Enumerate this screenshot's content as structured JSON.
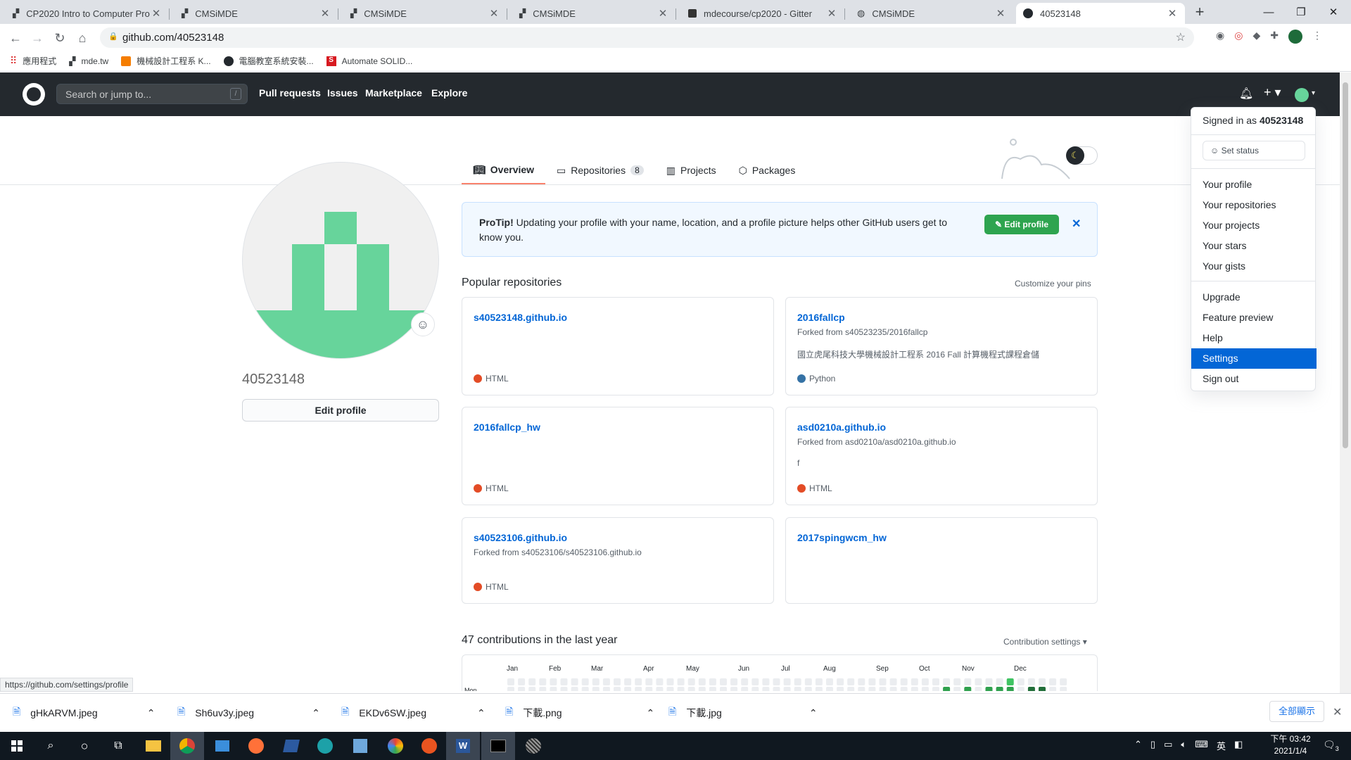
{
  "browser": {
    "tabs": [
      {
        "title": "CP2020 Intro to Computer Pro"
      },
      {
        "title": "CMSiMDE"
      },
      {
        "title": "CMSiMDE"
      },
      {
        "title": "CMSiMDE"
      },
      {
        "title": "mdecourse/cp2020 - Gitter"
      },
      {
        "title": "CMSiMDE"
      },
      {
        "title": "40523148"
      }
    ],
    "url": "github.com/40523148",
    "bookmarks": [
      "應用程式",
      "mde.tw",
      "機械設計工程系 K...",
      "電腦教室系統安裝...",
      "Automate SOLID..."
    ],
    "status_url": "https://github.com/settings/profile"
  },
  "github": {
    "search_placeholder": "Search or jump to...",
    "search_key": "/",
    "nav": [
      "Pull requests",
      "Issues",
      "Marketplace",
      "Explore"
    ],
    "profile_tabs": [
      {
        "label": "Overview"
      },
      {
        "label": "Repositories",
        "count": "8"
      },
      {
        "label": "Projects"
      },
      {
        "label": "Packages"
      }
    ],
    "username": "40523148",
    "edit_profile": "Edit profile",
    "protip_bold": "ProTip!",
    "protip_text": " Updating your profile with your name, location, and a profile picture helps other GitHub users get to know you.",
    "protip_button": "Edit profile",
    "popular_title": "Popular repositories",
    "customize_pins": "Customize your pins",
    "repos": [
      {
        "name": "s40523148.github.io",
        "fork": "",
        "desc": "",
        "lang": "HTML",
        "color": "#e34c26"
      },
      {
        "name": "2016fallcp",
        "fork": "Forked from s40523235/2016fallcp",
        "desc": "國立虎尾科技大學機械設計工程系 2016 Fall 計算機程式課程倉儲",
        "lang": "Python",
        "color": "#3572A5"
      },
      {
        "name": "2016fallcp_hw",
        "fork": "",
        "desc": "",
        "lang": "HTML",
        "color": "#e34c26"
      },
      {
        "name": "asd0210a.github.io",
        "fork": "Forked from asd0210a/asd0210a.github.io",
        "desc": "f",
        "lang": "HTML",
        "color": "#e34c26"
      },
      {
        "name": "s40523106.github.io",
        "fork": "Forked from s40523106/s40523106.github.io",
        "desc": "",
        "lang": "HTML",
        "color": "#e34c26"
      },
      {
        "name": "2017spingwcm_hw",
        "fork": "",
        "desc": "",
        "lang": "",
        "color": ""
      }
    ],
    "contrib_title": "47 contributions in the last year",
    "contrib_settings": "Contribution settings ▾",
    "months": [
      "Jan",
      "Feb",
      "Mar",
      "Apr",
      "May",
      "Jun",
      "Jul",
      "Aug",
      "Sep",
      "Oct",
      "Nov",
      "Dec"
    ],
    "day_label": "Mon",
    "dropdown": {
      "signed_in_prefix": "Signed in as ",
      "signed_in_user": "40523148",
      "set_status": "Set status",
      "group1": [
        "Your profile",
        "Your repositories",
        "Your projects",
        "Your stars",
        "Your gists"
      ],
      "group2": [
        "Upgrade",
        "Feature preview",
        "Help",
        "Settings",
        "Sign out"
      ],
      "selected": "Settings"
    }
  },
  "downloads": {
    "files": [
      "gHkARVM.jpeg",
      "Sh6uv3y.jpeg",
      "EKDv6SW.jpeg",
      "下載.png",
      "下載.jpg"
    ],
    "show_all": "全部顯示"
  },
  "taskbar": {
    "time": "下午 03:42",
    "date": "2021/1/4",
    "ime": "英",
    "notif_count": "3"
  },
  "colors": {
    "gh_header": "#24292e",
    "link": "#0366d6",
    "green": "#2ea44f",
    "avatar_green": "#67d49b",
    "selected": "#0366d6"
  }
}
